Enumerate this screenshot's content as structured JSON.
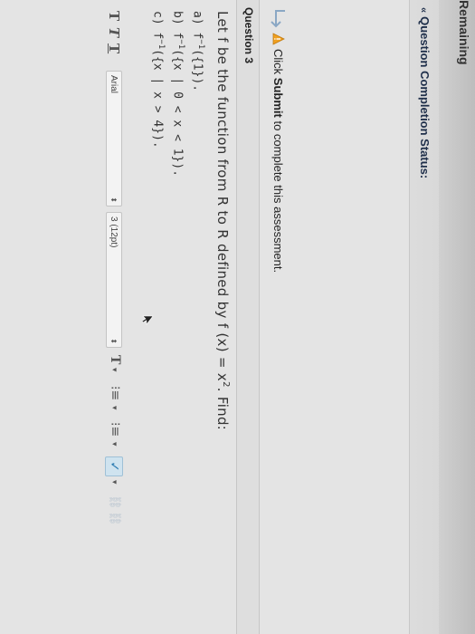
{
  "header": {
    "timer_text": "Remaining"
  },
  "status": {
    "label": "Question Completion Status:"
  },
  "instructions": {
    "prefix": "Click ",
    "bold": "Submit",
    "suffix": " to complete this assessment."
  },
  "question": {
    "title": "Question 3",
    "main_prefix": "Let f be the function from R to R defined by f (x) = x",
    "exponent": "2",
    "main_suffix": ". Find:",
    "parts": [
      {
        "label": "a) ",
        "fn": "f",
        "sup": "−1",
        "arg": "({1})."
      },
      {
        "label": "b) ",
        "fn": "f",
        "sup": "−1",
        "arg": "({x | 0 < x < 1})."
      },
      {
        "label": "c) ",
        "fn": "f",
        "sup": "−1",
        "arg": "({x | x > 4})."
      }
    ]
  },
  "toolbar": {
    "style_buttons": [
      "T",
      "T",
      "T"
    ],
    "font_family": "Arial",
    "font_size": "3 (12pt)",
    "text_color_glyph": "T",
    "list_unordered_glyph": "⁝≡",
    "list_ordered_glyph": "⁝≡",
    "spellcheck_glyph": "✓"
  },
  "colors": {
    "panel": "#e4e4e4",
    "status_text": "#1f2f4a",
    "warning": "#f0a020",
    "accent": "#2a7ab0"
  }
}
